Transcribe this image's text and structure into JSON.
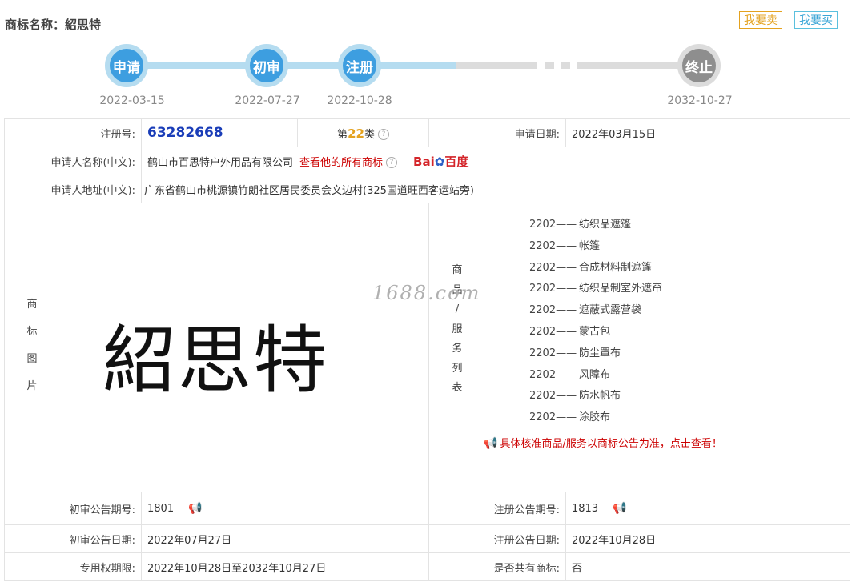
{
  "header": {
    "label": "商标名称：",
    "name": "紹思特",
    "sell_btn": "我要卖",
    "buy_btn": "我要买"
  },
  "timeline": {
    "nodes": [
      {
        "label": "申请",
        "date": "2022-03-15"
      },
      {
        "label": "初审",
        "date": "2022-07-27"
      },
      {
        "label": "注册",
        "date": "2022-10-28"
      },
      {
        "label": "终止",
        "date": "2032-10-27"
      }
    ]
  },
  "info": {
    "reg_no_label": "注册号:",
    "reg_no": "63282668",
    "class_prefix": "第",
    "class_num": "22",
    "class_suffix": "类",
    "apply_date_label": "申请日期:",
    "apply_date": "2022年03月15日",
    "applicant_label": "申请人名称(中文):",
    "applicant": "鹤山市百思特户外用品有限公司",
    "view_all_link": "查看他的所有商标",
    "baidu_label": "Bai",
    "baidu_label2": "百度",
    "address_label": "申请人地址(中文):",
    "address": "广东省鹤山市桃源镇竹朗社区居民委员会文边村(325国道旺西客运站旁)",
    "mark_image_label": [
      "商",
      "标",
      "图",
      "片"
    ],
    "mark_image_text": "紹思特",
    "goods_label": [
      "商",
      "品",
      "/",
      "服",
      "务",
      "列",
      "表"
    ],
    "goods": [
      {
        "code": "2202——",
        "name": "纺织品遮篷"
      },
      {
        "code": "2202——",
        "name": "帐篷"
      },
      {
        "code": "2202——",
        "name": "合成材料制遮篷"
      },
      {
        "code": "2202——",
        "name": "纺织品制室外遮帘"
      },
      {
        "code": "2202——",
        "name": "遮蔽式露营袋"
      },
      {
        "code": "2202——",
        "name": "蒙古包"
      },
      {
        "code": "2202——",
        "name": "防尘罩布"
      },
      {
        "code": "2202——",
        "name": "风障布"
      },
      {
        "code": "2202——",
        "name": "防水帆布"
      },
      {
        "code": "2202——",
        "name": "涂胶布"
      }
    ],
    "goods_notice": "具体核准商品/服务以商标公告为准，点击查看！",
    "watermark": "1688.com",
    "prelim_no_label": "初审公告期号:",
    "prelim_no": "1801",
    "reg_notice_no_label": "注册公告期号:",
    "reg_notice_no": "1813",
    "prelim_date_label": "初审公告日期:",
    "prelim_date": "2022年07月27日",
    "reg_notice_date_label": "注册公告日期:",
    "reg_notice_date": "2022年10月28日",
    "exclusive_label": "专用权期限:",
    "exclusive": "2022年10月28日至2032年10月27日",
    "shared_label": "是否共有商标:",
    "shared": "否"
  },
  "colors": {
    "blue_node": "#3d9ee0",
    "gray_node": "#8e8e8e",
    "reg_no": "#1a3db8",
    "accent_orange": "#e4a21f",
    "link_red": "#cc0000"
  }
}
